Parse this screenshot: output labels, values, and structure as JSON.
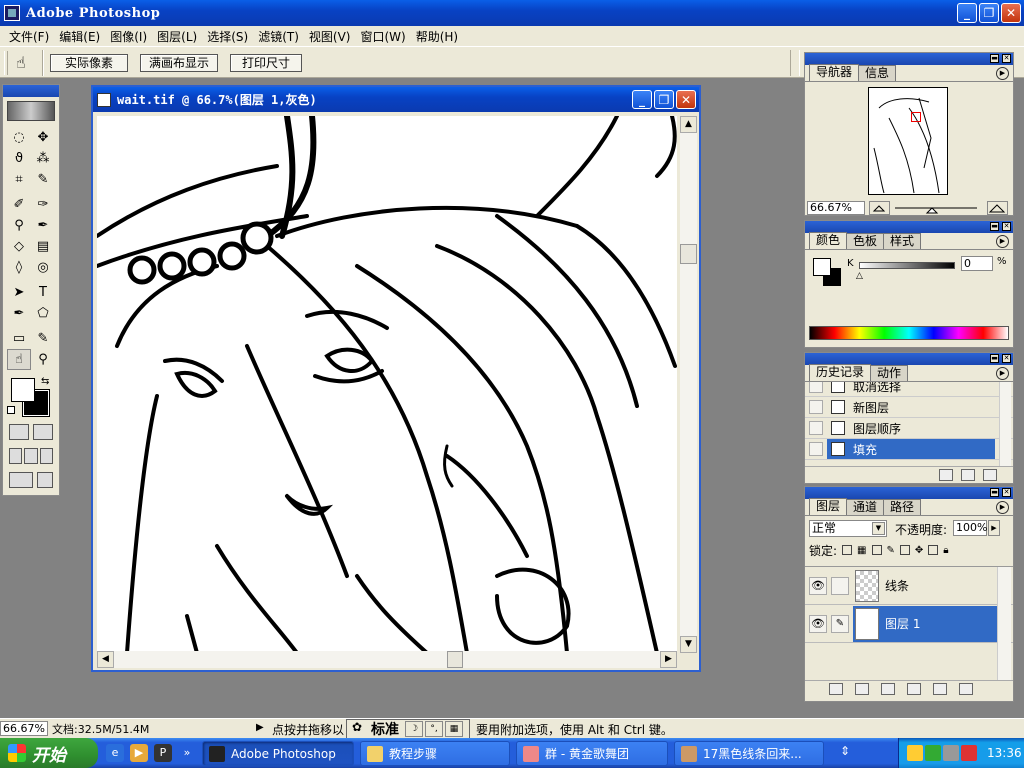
{
  "app": {
    "title": "Adobe Photoshop"
  },
  "window_controls": {
    "minimize": "_",
    "restore": "❐",
    "close": "✕"
  },
  "menu": [
    "文件(F)",
    "编辑(E)",
    "图像(I)",
    "图层(L)",
    "选择(S)",
    "滤镜(T)",
    "视图(V)",
    "窗口(W)",
    "帮助(H)"
  ],
  "options": {
    "tool_icon": "hand-icon",
    "buttons": [
      "实际像素",
      "满画布显示",
      "打印尺寸"
    ]
  },
  "document": {
    "title": "wait.tif @ 66.7%(图层 1,灰色)"
  },
  "navigator": {
    "tabs": [
      "导航器",
      "信息"
    ],
    "zoom": "66.67%"
  },
  "color_palette": {
    "tabs": [
      "颜色",
      "色板",
      "样式"
    ],
    "channel_label": "K",
    "value": "0",
    "unit": "%"
  },
  "history": {
    "tabs": [
      "历史记录",
      "动作"
    ],
    "items": [
      {
        "label": "取消选择",
        "selected": false
      },
      {
        "label": "新图层",
        "selected": false
      },
      {
        "label": "图层顺序",
        "selected": false
      },
      {
        "label": "填充",
        "selected": true
      }
    ]
  },
  "layers": {
    "tabs": [
      "图层",
      "通道",
      "路径"
    ],
    "blend_mode": "正常",
    "opacity_label": "不透明度:",
    "opacity": "100%",
    "lock_label": "锁定:",
    "items": [
      {
        "name": "线条",
        "visible": true,
        "selected": false
      },
      {
        "name": "图层 1",
        "visible": true,
        "selected": true
      }
    ]
  },
  "status": {
    "zoom": "66.67%",
    "doc": "文档:32.5M/51.4M",
    "hint": "点按并拖移以",
    "ime_label": "标准",
    "hint2": "要用附加选项，使用 Alt 和 Ctrl 键。"
  },
  "taskbar": {
    "start": "开始",
    "buttons": [
      {
        "label": "Adobe Photoshop",
        "active": true
      },
      {
        "label": "教程步骤",
        "active": false
      },
      {
        "label": "群 - 黄金歌舞团",
        "active": false
      },
      {
        "label": "17黑色线条回来...",
        "active": false
      }
    ],
    "clock": "13:36"
  },
  "colors": {
    "titlebar": "#0842c4",
    "chrome": "#ece9d8",
    "workspace": "#828282",
    "selection": "#316ac5",
    "start_green": "#2f8f2f"
  }
}
